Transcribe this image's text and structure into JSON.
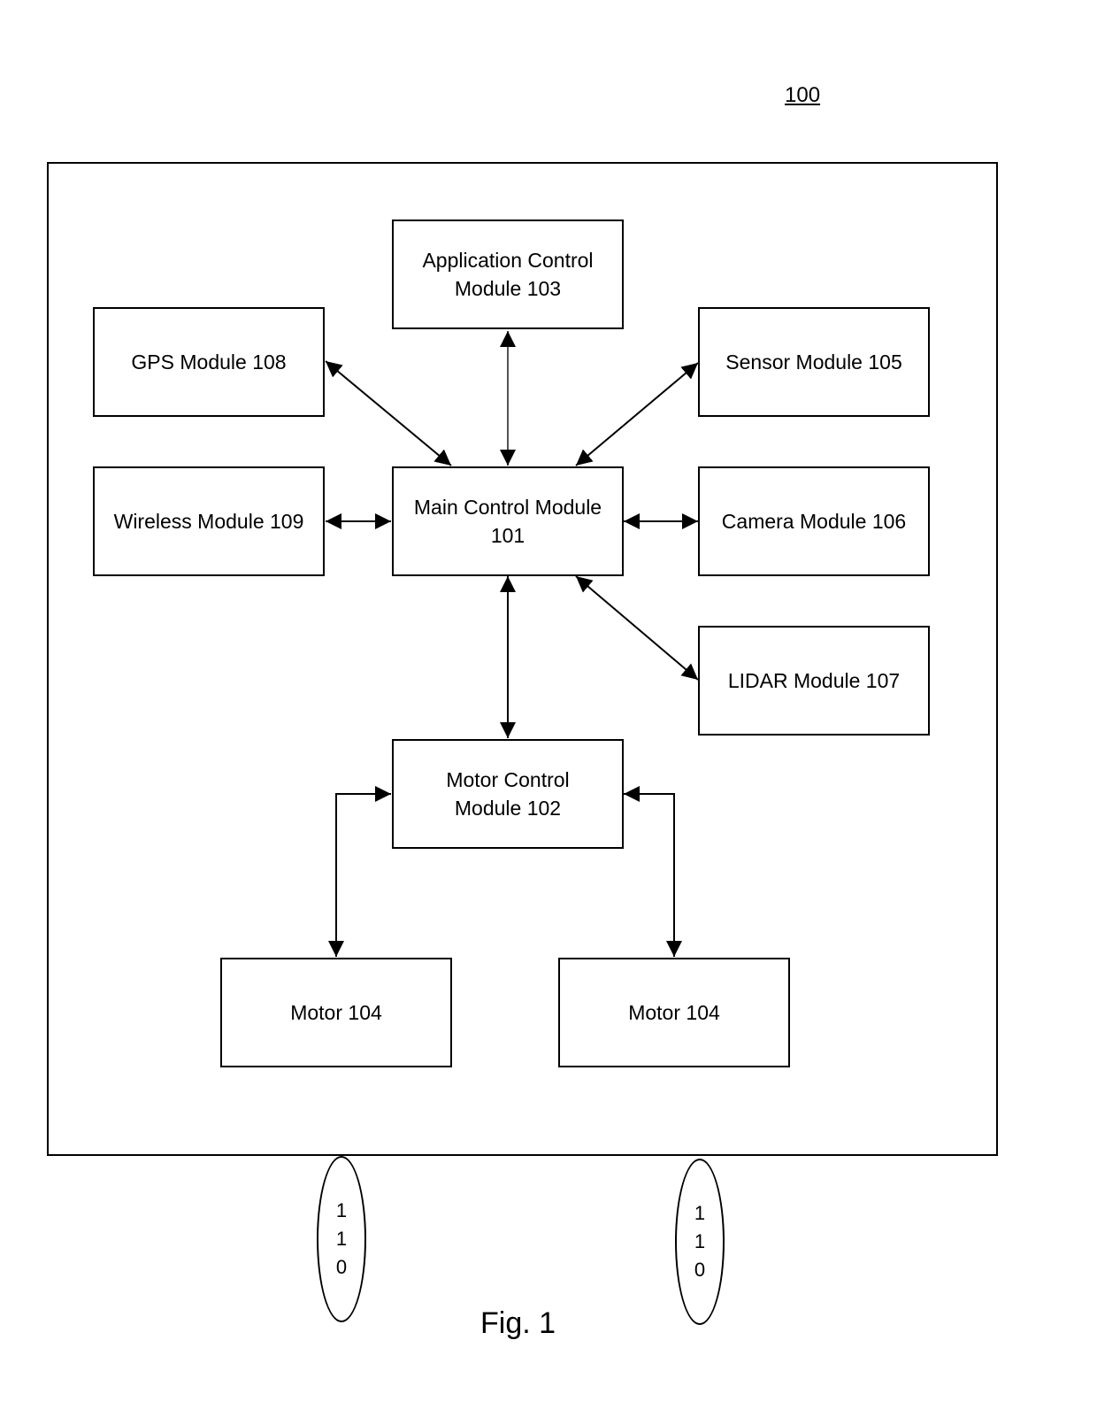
{
  "figure": {
    "reference_numeral": "100",
    "caption": "Fig. 1"
  },
  "modules": {
    "application_control": {
      "line1": "Application Control",
      "line2": "Module 103"
    },
    "gps": {
      "line1": "GPS Module 108"
    },
    "sensor": {
      "line1": "Sensor Module 105"
    },
    "wireless": {
      "line1": "Wireless Module 109"
    },
    "main_control": {
      "line1": "Main Control Module",
      "line2": "101"
    },
    "camera": {
      "line1": "Camera Module 106"
    },
    "lidar": {
      "line1": "LIDAR Module 107"
    },
    "motor_control": {
      "line1": "Motor Control",
      "line2": "Module 102"
    },
    "motor_left": {
      "line1": "Motor 104"
    },
    "motor_right": {
      "line1": "Motor 104"
    }
  },
  "wheels": [
    {
      "digits": [
        "1",
        "1",
        "0"
      ]
    },
    {
      "digits": [
        "1",
        "1",
        "0"
      ]
    }
  ],
  "connections": [
    {
      "from": "Application Control Module 103",
      "to": "Main Control Module 101",
      "type": "bidirectional"
    },
    {
      "from": "GPS Module 108",
      "to": "Main Control Module 101",
      "type": "bidirectional"
    },
    {
      "from": "Sensor Module 105",
      "to": "Main Control Module 101",
      "type": "bidirectional"
    },
    {
      "from": "Wireless Module 109",
      "to": "Main Control Module 101",
      "type": "bidirectional"
    },
    {
      "from": "Camera Module 106",
      "to": "Main Control Module 101",
      "type": "bidirectional"
    },
    {
      "from": "LIDAR Module 107",
      "to": "Main Control Module 101",
      "type": "bidirectional"
    },
    {
      "from": "Main Control Module 101",
      "to": "Motor Control Module 102",
      "type": "bidirectional"
    },
    {
      "from": "Motor Control Module 102",
      "to": "Motor 104 (left)",
      "type": "bidirectional"
    },
    {
      "from": "Motor Control Module 102",
      "to": "Motor 104 (right)",
      "type": "bidirectional"
    }
  ]
}
